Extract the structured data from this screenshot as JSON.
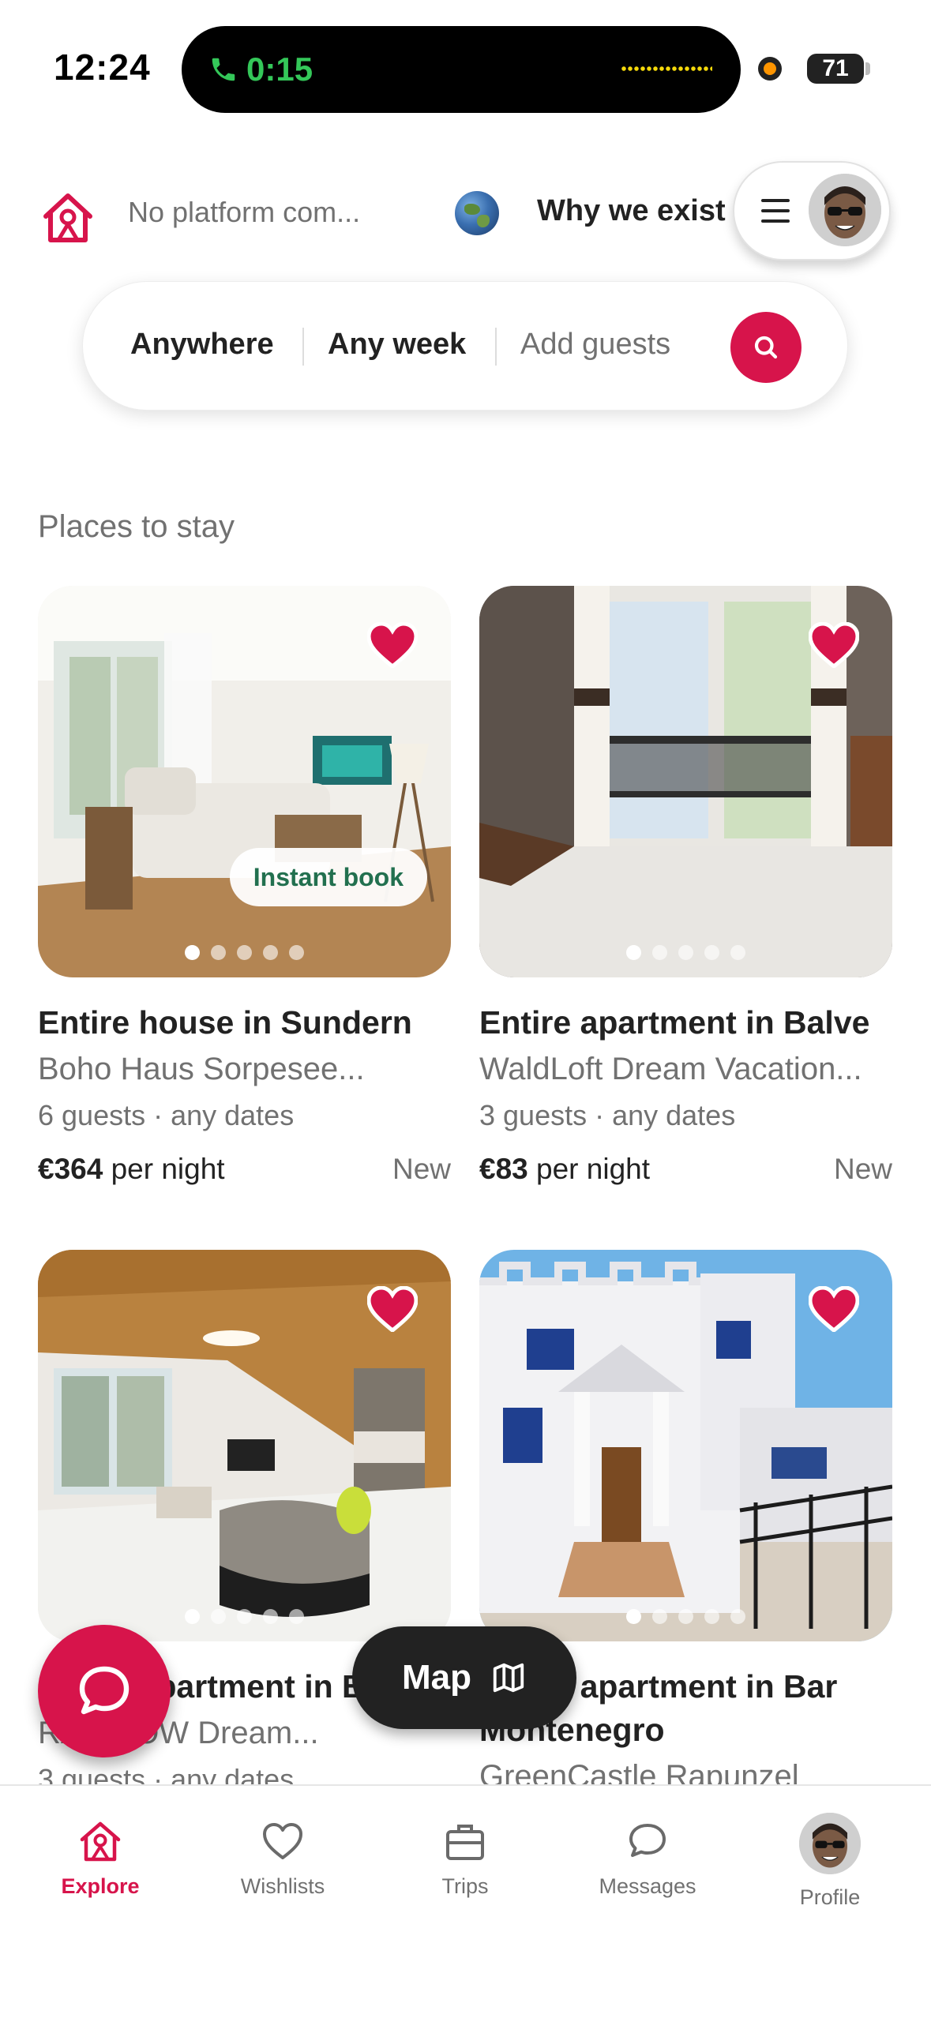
{
  "status_bar": {
    "time": "12:24",
    "call_timer": "0:15",
    "battery": "71"
  },
  "header": {
    "title": "No platform com...",
    "link": "Why we exist"
  },
  "search": {
    "where": "Anywhere",
    "when": "Any week",
    "guests": "Add guests"
  },
  "section_title": "Places to stay",
  "listings": [
    {
      "title": "Entire house in Sundern",
      "subtitle": "Boho Haus Sorpesee...",
      "guests": "6 guests",
      "dates": "any dates",
      "price": "€364",
      "price_unit": "per night",
      "tag": "New",
      "badge": "Instant book",
      "wishlisted": true,
      "photo_count": 5,
      "active_photo": 1
    },
    {
      "title": "Entire apartment in Balve",
      "subtitle": "WaldLoft Dream Vacation...",
      "guests": "3 guests",
      "dates": "any dates",
      "price": "€83",
      "price_unit": "per night",
      "tag": "New",
      "wishlisted": true,
      "photo_count": 5,
      "active_photo": 1
    },
    {
      "title": "Entire apartment in B",
      "subtitle": "RAINBOW Dream...",
      "guests": "3 guests",
      "dates": "any dates",
      "wishlisted": true,
      "photo_count": 5,
      "active_photo": 1
    },
    {
      "title": "Entire apartment in Bar",
      "title_line2": "Montenegro",
      "subtitle": "GreenCastle Rapunzel",
      "wishlisted": true,
      "photo_count": 5,
      "active_photo": 1
    }
  ],
  "map_button": "Map",
  "tabs": [
    {
      "label": "Explore",
      "icon": "home-icon",
      "active": true
    },
    {
      "label": "Wishlists",
      "icon": "heart-icon"
    },
    {
      "label": "Trips",
      "icon": "briefcase-icon"
    },
    {
      "label": "Messages",
      "icon": "chat-bubble-icon"
    },
    {
      "label": "Profile",
      "icon": "avatar"
    }
  ],
  "colors": {
    "brand": "#d7144b",
    "text_primary": "#222222",
    "text_secondary": "#717171",
    "badge_text": "#22704f",
    "call_green": "#34c759"
  }
}
